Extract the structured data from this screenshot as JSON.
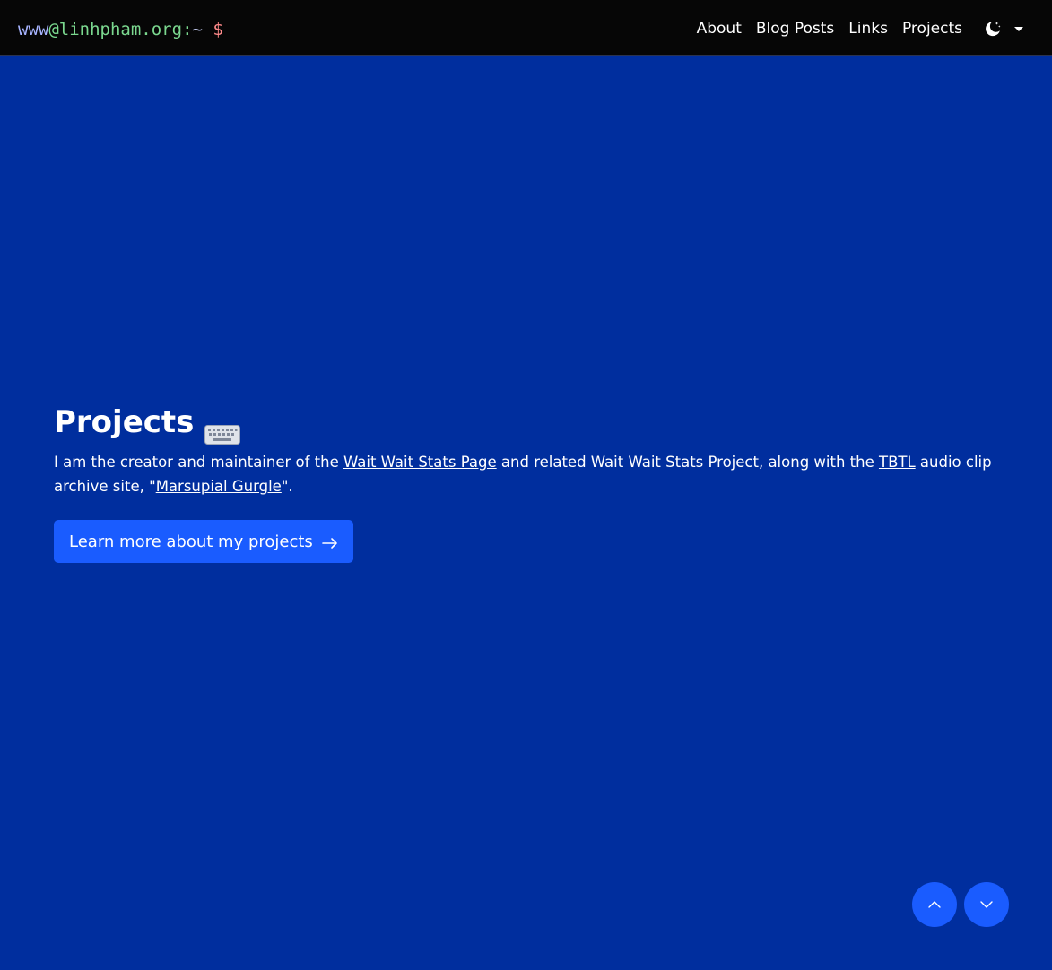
{
  "brand": {
    "user": "www",
    "at": "@",
    "host": "linhpham.org",
    "colon": ":",
    "tilde": "~",
    "prompt": "$"
  },
  "nav": {
    "items": [
      {
        "label": "About"
      },
      {
        "label": "Blog Posts"
      },
      {
        "label": "Links"
      },
      {
        "label": "Projects"
      }
    ],
    "theme_icon": "moon-stars-icon"
  },
  "hero": {
    "title": "Projects",
    "title_icon": "keyboard-icon",
    "intro_part1": "I am the creator and maintainer of the ",
    "link_wait_wait": "Wait Wait Stats Page",
    "intro_part2": " and related Wait Wait Stats Project, along with the ",
    "link_tbtl": "TBTL",
    "intro_part3": " audio clip archive site, \"",
    "link_marsupial": "Marsupial Gurgle",
    "intro_part4": "\".",
    "cta_label": "Learn more about my projects",
    "cta_icon": "arrow-right-icon"
  },
  "scroll": {
    "up_icon": "chevron-up-icon",
    "down_icon": "chevron-down-icon"
  },
  "colors": {
    "background": "#002e9e",
    "navbar": "#060606",
    "accent": "#1a5cff"
  }
}
